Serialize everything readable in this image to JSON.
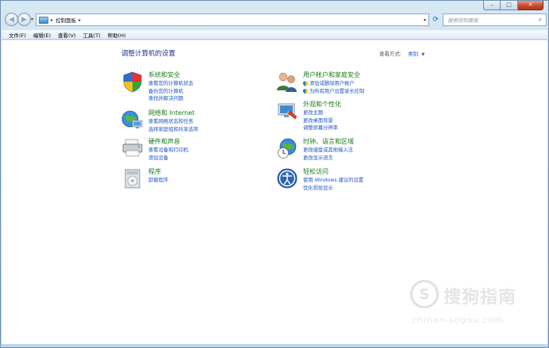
{
  "window": {
    "caption": {
      "minimize": "–",
      "maximize": "□",
      "close": "✕"
    }
  },
  "address": {
    "crumb": "控制面板",
    "search_placeholder": "搜索控制面板"
  },
  "menu": [
    "文件(F)",
    "编辑(E)",
    "查看(V)",
    "工具(T)",
    "帮助(H)"
  ],
  "main": {
    "title": "调整计算机的设置",
    "view_by_label": "查看方式:",
    "view_by_value": "类别"
  },
  "categories": [
    {
      "title": "系统和安全",
      "icon": "system-security-icon",
      "links": [
        {
          "text": "查看您的计算机状态",
          "shield": false
        },
        {
          "text": "备份您的计算机",
          "shield": false
        },
        {
          "text": "查找并解决问题",
          "shield": false
        }
      ]
    },
    {
      "title": "网络和 Internet",
      "icon": "network-icon",
      "links": [
        {
          "text": "查看网络状态和任务",
          "shield": false
        },
        {
          "text": "选择家庭组和共享选项",
          "shield": false
        }
      ]
    },
    {
      "title": "硬件和声音",
      "icon": "hardware-sound-icon",
      "links": [
        {
          "text": "查看设备和打印机",
          "shield": false
        },
        {
          "text": "添加设备",
          "shield": false
        }
      ]
    },
    {
      "title": "程序",
      "icon": "programs-icon",
      "links": [
        {
          "text": "卸载程序",
          "shield": false
        }
      ]
    },
    {
      "title": "用户帐户和家庭安全",
      "icon": "user-accounts-icon",
      "links": [
        {
          "text": "添加或删除用户帐户",
          "shield": true
        },
        {
          "text": "为所有用户设置家长控制",
          "shield": true
        }
      ]
    },
    {
      "title": "外观和个性化",
      "icon": "appearance-icon",
      "links": [
        {
          "text": "更改主题",
          "shield": false
        },
        {
          "text": "更改桌面背景",
          "shield": false
        },
        {
          "text": "调整屏幕分辨率",
          "shield": false
        }
      ]
    },
    {
      "title": "时钟、语言和区域",
      "icon": "clock-language-icon",
      "links": [
        {
          "text": "更改键盘或其他输入法",
          "shield": false
        },
        {
          "text": "更改显示语言",
          "shield": false
        }
      ]
    },
    {
      "title": "轻松访问",
      "icon": "ease-of-access-icon",
      "links": [
        {
          "text": "使用 Windows 建议的设置",
          "shield": false
        },
        {
          "text": "优化视觉显示",
          "shield": false
        }
      ]
    }
  ],
  "watermark": {
    "logo_letter": "S",
    "text": "搜狗指南",
    "url": "zhinan.sogou.com"
  }
}
